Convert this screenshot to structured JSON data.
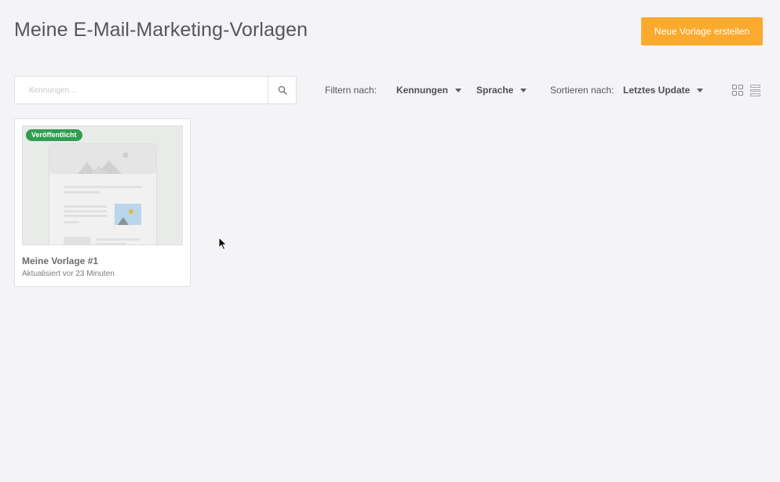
{
  "header": {
    "title": "Meine E-Mail-Marketing-Vorlagen",
    "create_button": "Neue Vorlage erstellen"
  },
  "search": {
    "placeholder": "Kennungen...",
    "value": "",
    "icon": "search-icon"
  },
  "filters": {
    "filter_label": "Filtern nach:",
    "filter_tags": "Kennungen",
    "filter_language": "Sprache",
    "sort_label": "Sortieren nach:",
    "sort_value": "Letztes Update"
  },
  "view_toggle": {
    "grid_icon": "grid-view-icon",
    "list_icon": "list-view-icon"
  },
  "templates": [
    {
      "status": "Veröffentlicht",
      "name": "Meine Vorlage #1",
      "updated": "Aktualisiert vor 23 Minuten"
    }
  ],
  "colors": {
    "accent": "#fbaa2e",
    "published_badge": "#2f9e4f",
    "background": "#f4f4f6"
  }
}
